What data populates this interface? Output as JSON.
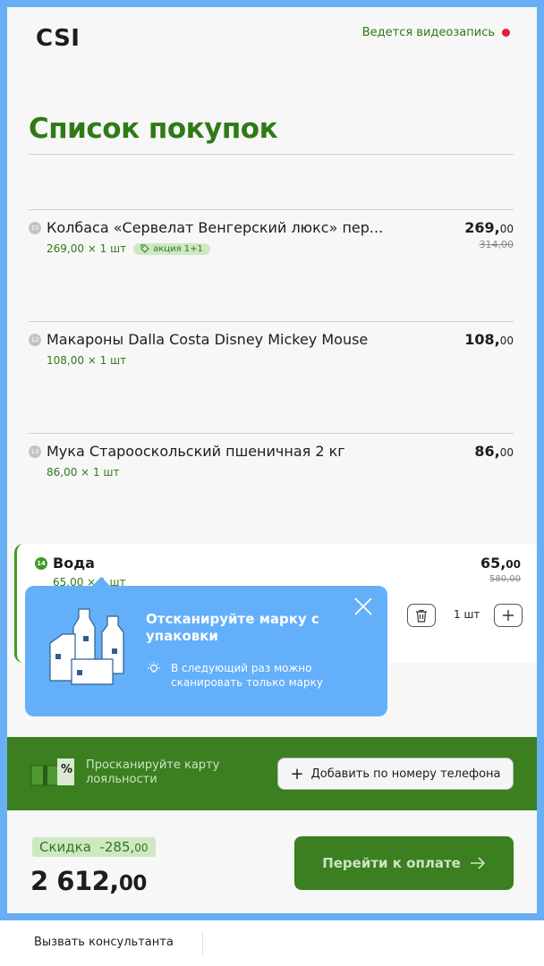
{
  "header": {
    "logo": "CSI",
    "recording_label": "Ведется видеозапись"
  },
  "page_title": "Список покупок",
  "items": [
    {
      "index": "10",
      "name": "Колбаса «Сервелат Венгерский люкс» пер...",
      "price_rub": "269,",
      "price_kop": "00",
      "old_price": "314,00",
      "detail": "269,00 × 1 шт",
      "promo": "акция 1+1"
    },
    {
      "index": "12",
      "name": "Макароны Dalla Costa Disney Mickey Mouse",
      "price_rub": "108,",
      "price_kop": "00",
      "detail": "108,00 × 1 шт"
    },
    {
      "index": "13",
      "name": "Мука Старооскольский пшеничная 2 кг",
      "price_rub": "86,",
      "price_kop": "00",
      "detail": "86,00 × 1 шт"
    }
  ],
  "active_item": {
    "index": "14",
    "name": "Вода",
    "price_rub": "65,",
    "price_kop": "00",
    "old_price": "580,00",
    "detail": "65,00 × 1 шт",
    "quantity": "1 шт"
  },
  "tooltip": {
    "title": "Отсканируйте марку с упаковки",
    "hint": "В следующий раз можно сканировать только марку"
  },
  "loyalty": {
    "text": "Просканируйте карту лояльности",
    "add_phone_label": "Добавить по номеру телефона"
  },
  "summary": {
    "discount_label": "Скидка",
    "discount_rub": "-285,",
    "discount_kop": "00",
    "total_rub": "2 612,",
    "total_kop": "00",
    "pay_label": "Перейти к оплате"
  },
  "footer": {
    "consultant_label": "Вызвать консультанта"
  },
  "colors": {
    "brand_green": "#3b7f20",
    "accent_green": "#2f7a17",
    "tooltip_blue": "#63affa",
    "record_red": "#e01e37"
  }
}
